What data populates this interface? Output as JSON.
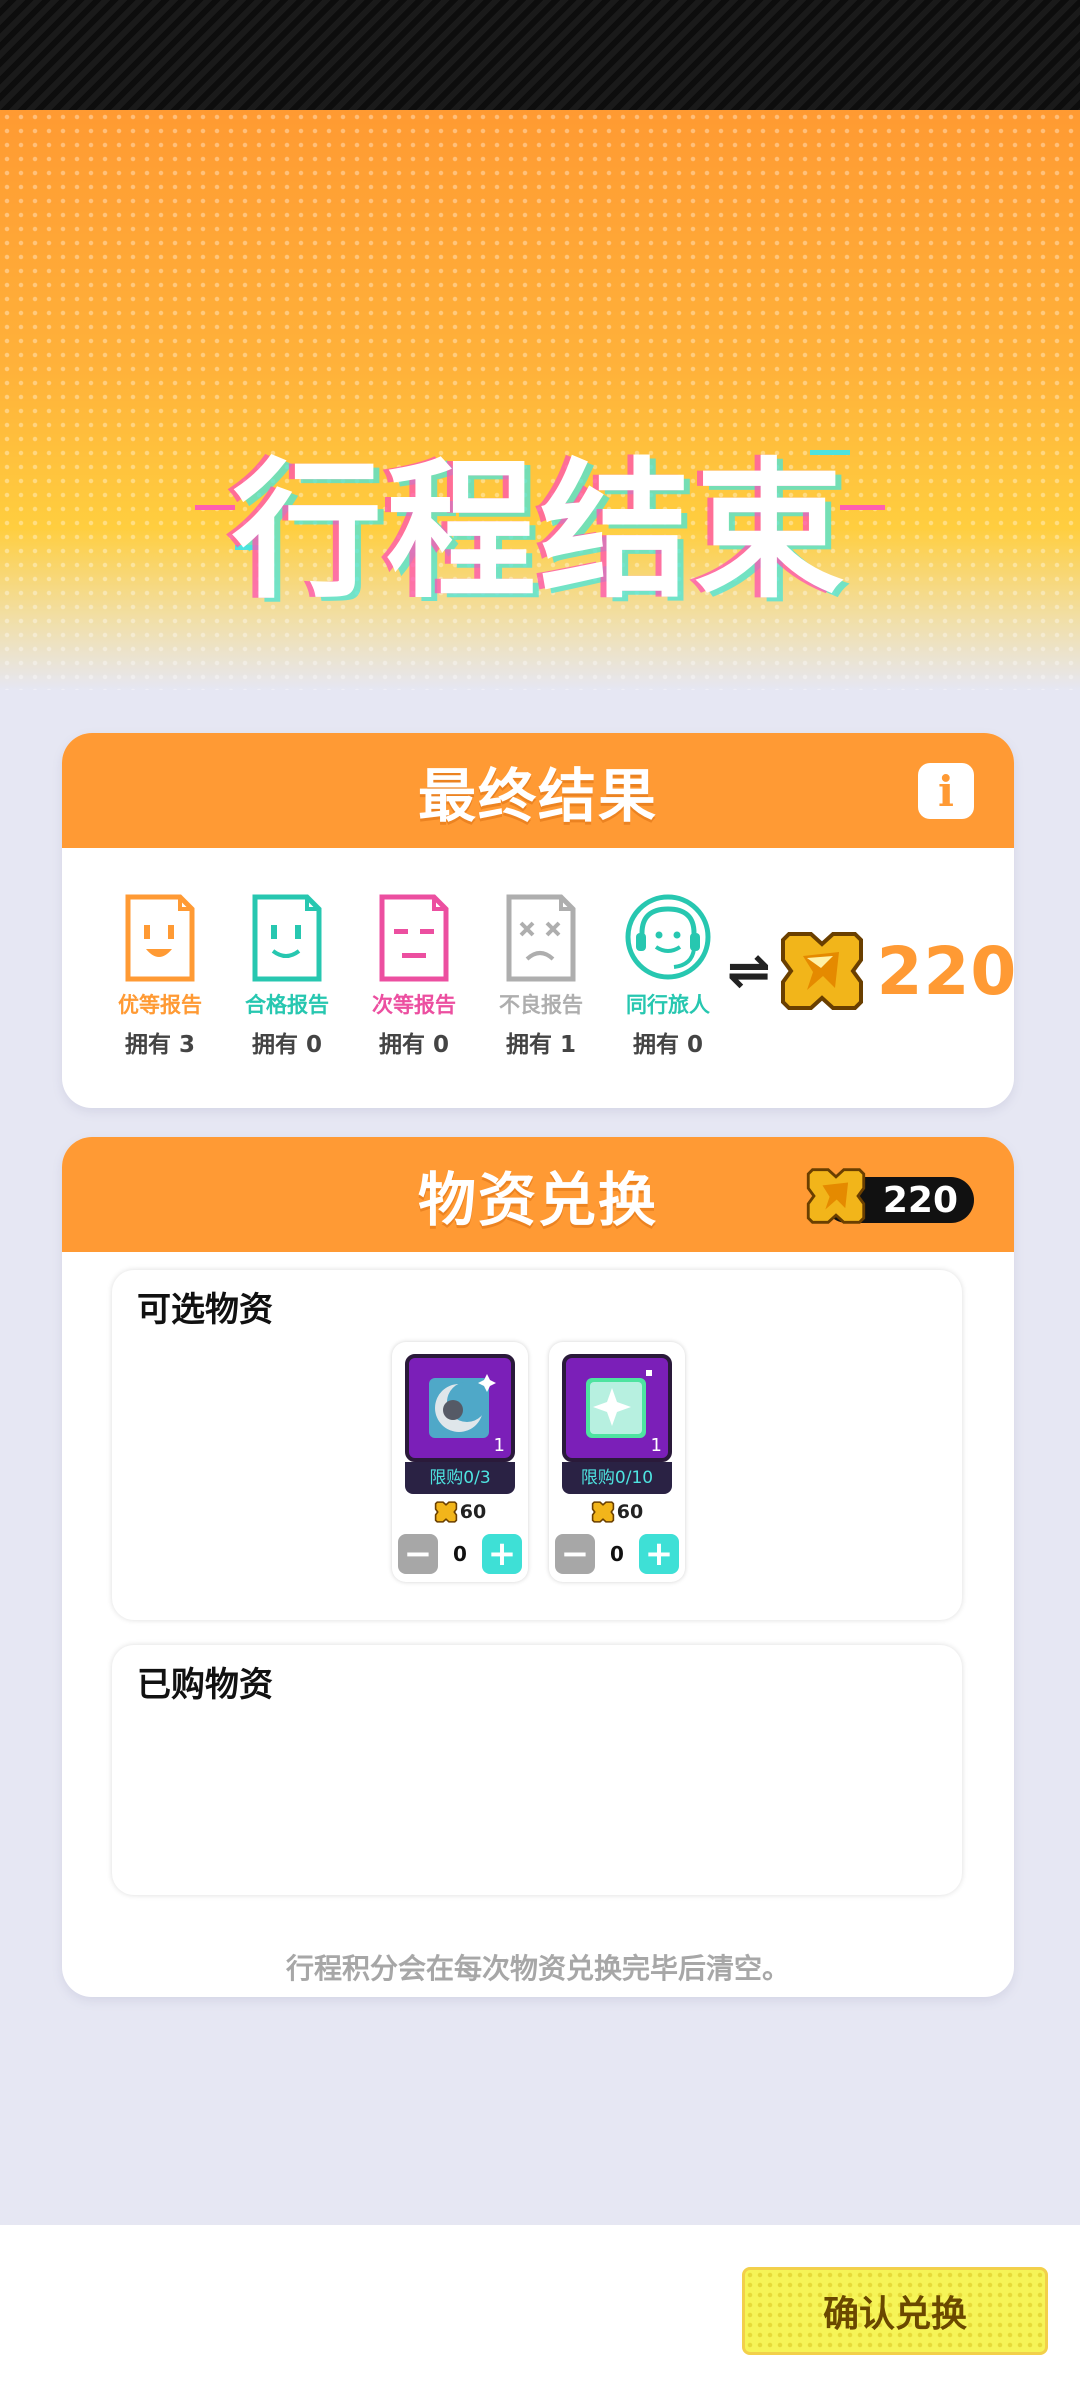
{
  "hero": {
    "title": "行程结束"
  },
  "result_card": {
    "title": "最终结果",
    "info_label": "i",
    "reports": [
      {
        "name": "优等报告",
        "count": "拥有 3",
        "color": "#ff9a34"
      },
      {
        "name": "合格报告",
        "count": "拥有 0",
        "color": "#27c7b0"
      },
      {
        "name": "次等报告",
        "count": "拥有 0",
        "color": "#ec4fa0"
      },
      {
        "name": "不良报告",
        "count": "拥有 1",
        "color": "#aeaeae"
      },
      {
        "name": "同行旅人",
        "count": "拥有 0",
        "color": "#27c7b0"
      }
    ],
    "exchange_symbol": "⇌",
    "total_points": "220"
  },
  "exchange_card": {
    "title": "物资兑换",
    "points": "220",
    "available_title": "可选物资",
    "items": [
      {
        "qty": "1",
        "limit": "限购0/3",
        "price": "60",
        "count": "0",
        "icon": "moon-character-icon"
      },
      {
        "qty": "1",
        "limit": "限购0/10",
        "price": "60",
        "count": "0",
        "icon": "sparkle-card-icon"
      }
    ],
    "purchased_title": "已购物资",
    "note": "行程积分会在每次物资兑换完毕后清空。"
  },
  "footer": {
    "confirm_label": "确认兑换"
  },
  "colors": {
    "accent": "#ff9a34",
    "teal": "#3ee0d6",
    "confirm": "#f6f457"
  }
}
